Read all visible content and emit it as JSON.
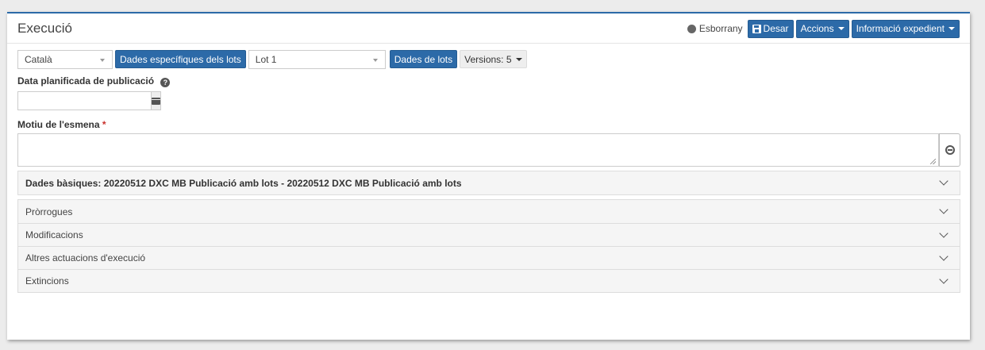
{
  "header": {
    "title": "Execució",
    "status_label": "Esborrany",
    "save_label": "Desar",
    "actions_label": "Accions",
    "info_label": "Informació expedient"
  },
  "toolbar": {
    "language_value": "Català",
    "lot_data_button": "Dades específiques dels lots",
    "lot_select_value": "Lot 1",
    "lots_data_button": "Dades de lots",
    "versions_label": "Versions: 5"
  },
  "form": {
    "publication_date_label": "Data planificada de publicació",
    "publication_date_value": "",
    "motiu_label": "Motiu de l'esmena",
    "required_mark": "*",
    "motiu_value": ""
  },
  "sections": [
    {
      "label": "Dades bàsiques:  20220512 DXC MB Publicació amb lots - 20220512 DXC MB Publicació amb lots",
      "bold": true
    },
    {
      "label": "Pròrrogues"
    },
    {
      "label": "Modificacions"
    },
    {
      "label": "Altres actuacions d'execució"
    },
    {
      "label": "Extincions"
    }
  ],
  "icons": {
    "status": "circle-icon",
    "save": "floppy-disk-icon",
    "help": "question-circle-icon",
    "calendar": "calendar-icon",
    "globe": "globe-icon",
    "chevron": "chevron-down-icon"
  },
  "colors": {
    "primary": "#2c6aa8",
    "required": "#c9302c",
    "status_dot": "#666666"
  }
}
